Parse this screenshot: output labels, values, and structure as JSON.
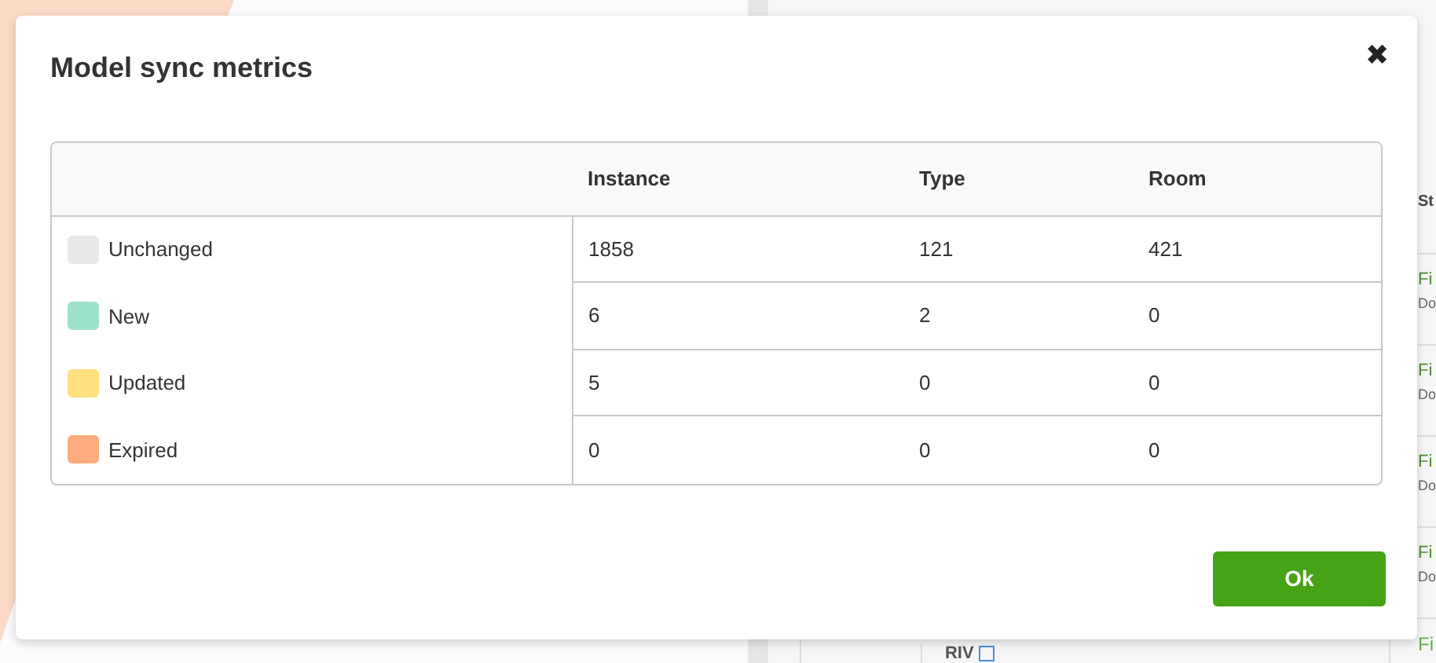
{
  "background": {
    "column_header": "St",
    "rows": [
      {
        "line_1": "Fi",
        "line_2": "Do"
      },
      {
        "line_1": "Fi",
        "line_2": "Do"
      },
      {
        "line_1": "Fi",
        "line_2": "Do"
      },
      {
        "line_1": "Fi",
        "line_2": "Do"
      }
    ],
    "footer_label": "RIV",
    "footer_last": "Fi"
  },
  "dialog": {
    "title": "Model sync metrics",
    "close": "✖",
    "table": {
      "columns": [
        "Instance",
        "Type",
        "Room"
      ],
      "rows": [
        {
          "status": "Unchanged",
          "color": "#e8e8e8",
          "values": [
            "1858",
            "121",
            "421"
          ]
        },
        {
          "status": "New",
          "color": "#9de3cb",
          "values": [
            "6",
            "2",
            "0"
          ]
        },
        {
          "status": "Updated",
          "color": "#ffe07f",
          "values": [
            "5",
            "0",
            "0"
          ]
        },
        {
          "status": "Expired",
          "color": "#ffab80",
          "values": [
            "0",
            "0",
            "0"
          ]
        }
      ]
    },
    "buttons": [
      "Ok"
    ]
  }
}
